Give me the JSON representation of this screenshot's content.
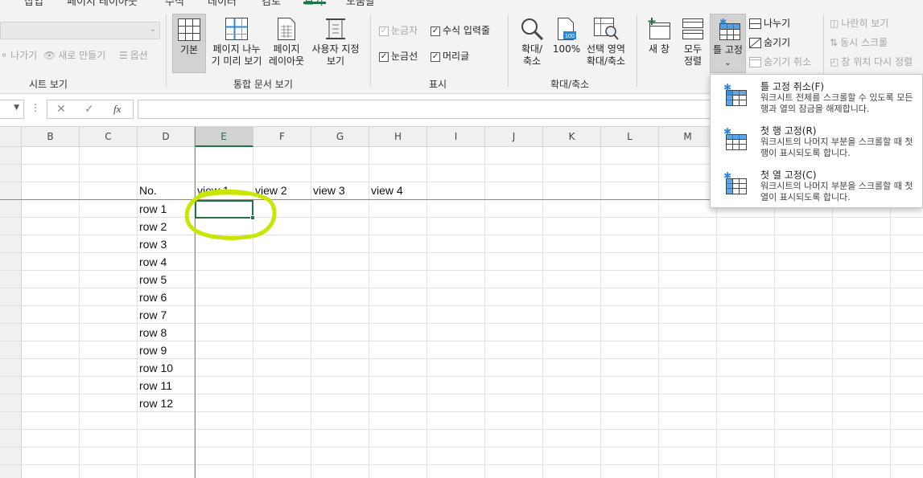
{
  "ribbon": {
    "tabs": [
      {
        "label": "삽입",
        "active": false
      },
      {
        "label": "페이지 레이아웃",
        "active": false
      },
      {
        "label": "수식",
        "active": false
      },
      {
        "label": "데이터",
        "active": false
      },
      {
        "label": "검토",
        "active": false
      },
      {
        "label": "보기",
        "active": true
      },
      {
        "label": "도움말",
        "active": false
      }
    ],
    "sheet_view": {
      "group_label": "시트 보기",
      "exit_label": "나가기",
      "new_label": "새로 만들기",
      "options_label": "옵션"
    },
    "workbook_views": {
      "group_label": "통합 문서 보기",
      "normal_label": "기본",
      "page_break_line1": "페이지 나누",
      "page_break_line2": "기 미리 보기",
      "page_layout_line1": "페이지",
      "page_layout_line2": "레이아웃",
      "custom_line1": "사용자 지정",
      "custom_line2": "보기"
    },
    "show": {
      "group_label": "표시",
      "ruler_label": "눈금자",
      "formula_bar_label": "수식 입력줄",
      "gridlines_label": "눈금선",
      "headings_label": "머리글"
    },
    "zoom": {
      "group_label": "확대/축소",
      "zoom_line1": "확대/",
      "zoom_line2": "축소",
      "zoom100_label": "100%",
      "zoom100_icon_text": "100",
      "selection_line1": "선택 영역",
      "selection_line2": "확대/축소"
    },
    "window": {
      "new_window_label": "새 창",
      "arrange_line1": "모두",
      "arrange_line2": "정렬",
      "freeze_label": "틀 고정",
      "split_label": "나누기",
      "hide_label": "숨기기",
      "unhide_label": "숨기기 취소",
      "side_by_side_label": "나란히 보기",
      "sync_scroll_label": "동시 스크롤",
      "reset_position_label": "창 위치 다시 정렬"
    }
  },
  "formula_bar": {
    "fx_label": "fx",
    "value": ""
  },
  "grid": {
    "columns": [
      "B",
      "C",
      "D",
      "E",
      "F",
      "G",
      "H",
      "I",
      "J",
      "K",
      "L",
      "M"
    ],
    "selected_column": "E",
    "header_row": [
      "No.",
      "view 1",
      "view 2",
      "view 3",
      "view 4"
    ],
    "row_labels": [
      "row 1",
      "row 2",
      "row 3",
      "row 4",
      "row 5",
      "row 6",
      "row 7",
      "row 8",
      "row 9",
      "row 10",
      "row 11",
      "row 12"
    ]
  },
  "freeze_menu": {
    "items": [
      {
        "title": "틀 고정 취소(F)",
        "desc": "워크시트 전체를 스크롤할 수 있도록 모든 행과 열의 잠금을 해제합니다."
      },
      {
        "title": "첫 행 고정(R)",
        "desc": "워크시트의 나머지 부분을 스크롤할 때 첫 행이 표시되도록 합니다."
      },
      {
        "title": "첫 열 고정(C)",
        "desc": "워크시트의 나머지 부분을 스크롤할 때 첫 열이 표시되도록 합니다."
      }
    ]
  },
  "colors": {
    "accent_green": "#217346",
    "highlight_scribble": "#c8e600",
    "icon_blue": "#2b88d8"
  }
}
